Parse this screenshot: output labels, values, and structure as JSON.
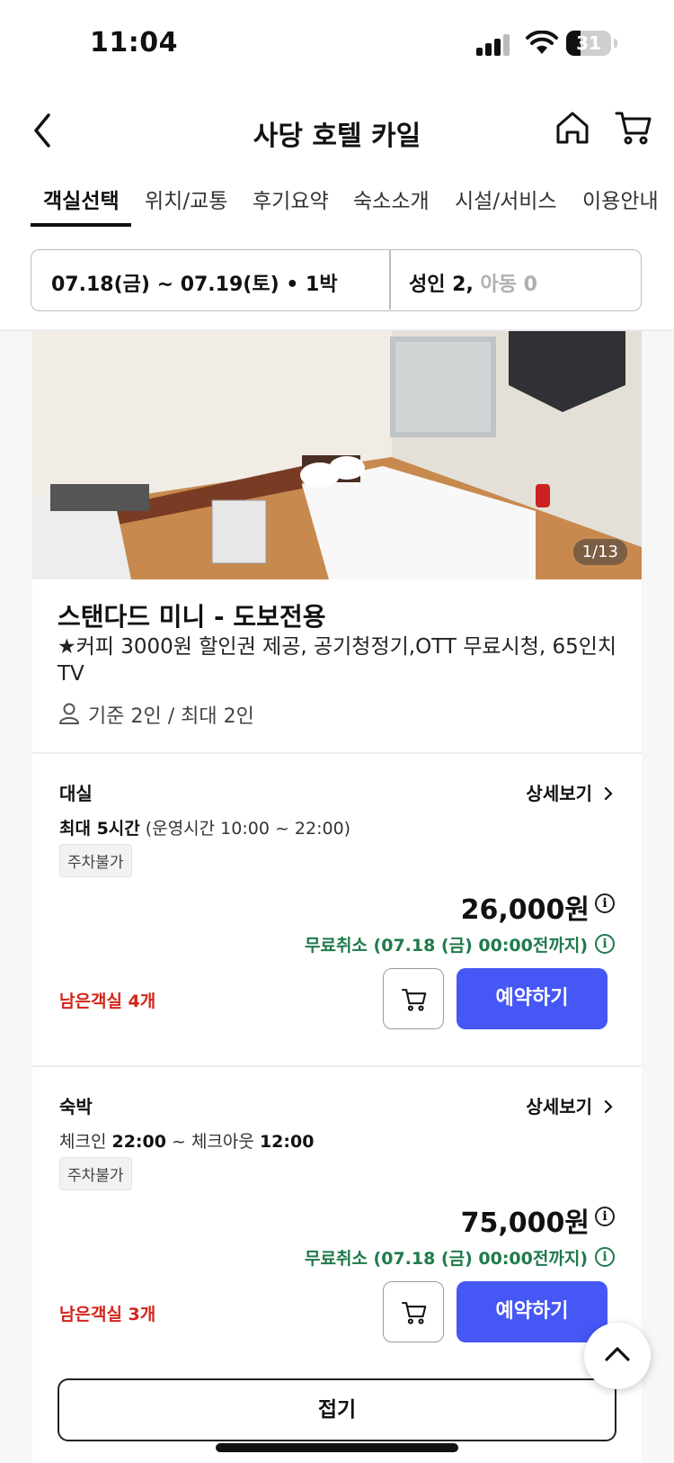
{
  "status_bar": {
    "time": "11:04",
    "battery": "31"
  },
  "header": {
    "title": "사당 호텔 카일"
  },
  "tabs": [
    {
      "label": "객실선택",
      "active": true
    },
    {
      "label": "위치/교통"
    },
    {
      "label": "후기요약"
    },
    {
      "label": "숙소소개"
    },
    {
      "label": "시설/서비스"
    },
    {
      "label": "이용안내"
    }
  ],
  "booking": {
    "dates": "07.18(금) ~ 07.19(토) • 1박",
    "adults": "성인 2,",
    "children": "아동 0"
  },
  "room": {
    "photo_counter": "1/13",
    "name": "스탠다드 미니 - 도보전용",
    "description": "★커피 3000원 할인권 제공, 공기청정기,OTT 무료시청, 65인치 TV",
    "capacity": "기준 2인 / 최대 2인"
  },
  "rates": [
    {
      "type": "대실",
      "detail_label": "상세보기",
      "hours_bold": "최대 5시간",
      "hours_rest": " (운영시간 10:00 ~ 22:00)",
      "parking": "주차불가",
      "price": "26,000원",
      "cancel": "무료취소 (07.18 (금) 00:00전까지)",
      "remaining": "남은객실 4개",
      "book_label": "예약하기"
    },
    {
      "type": "숙박",
      "detail_label": "상세보기",
      "checkin_label": "체크인 ",
      "checkin_time": "22:00",
      "checkout_label": " ~ 체크아웃 ",
      "checkout_time": "12:00",
      "parking": "주차불가",
      "price": "75,000원",
      "cancel": "무료취소 (07.18 (금) 00:00전까지)",
      "remaining": "남은객실 3개",
      "book_label": "예약하기"
    }
  ],
  "collapse_label": "접기",
  "colors": {
    "accent": "#4557f5",
    "cancel_green": "#1f7a4a",
    "remaining_red": "#d3251b"
  }
}
